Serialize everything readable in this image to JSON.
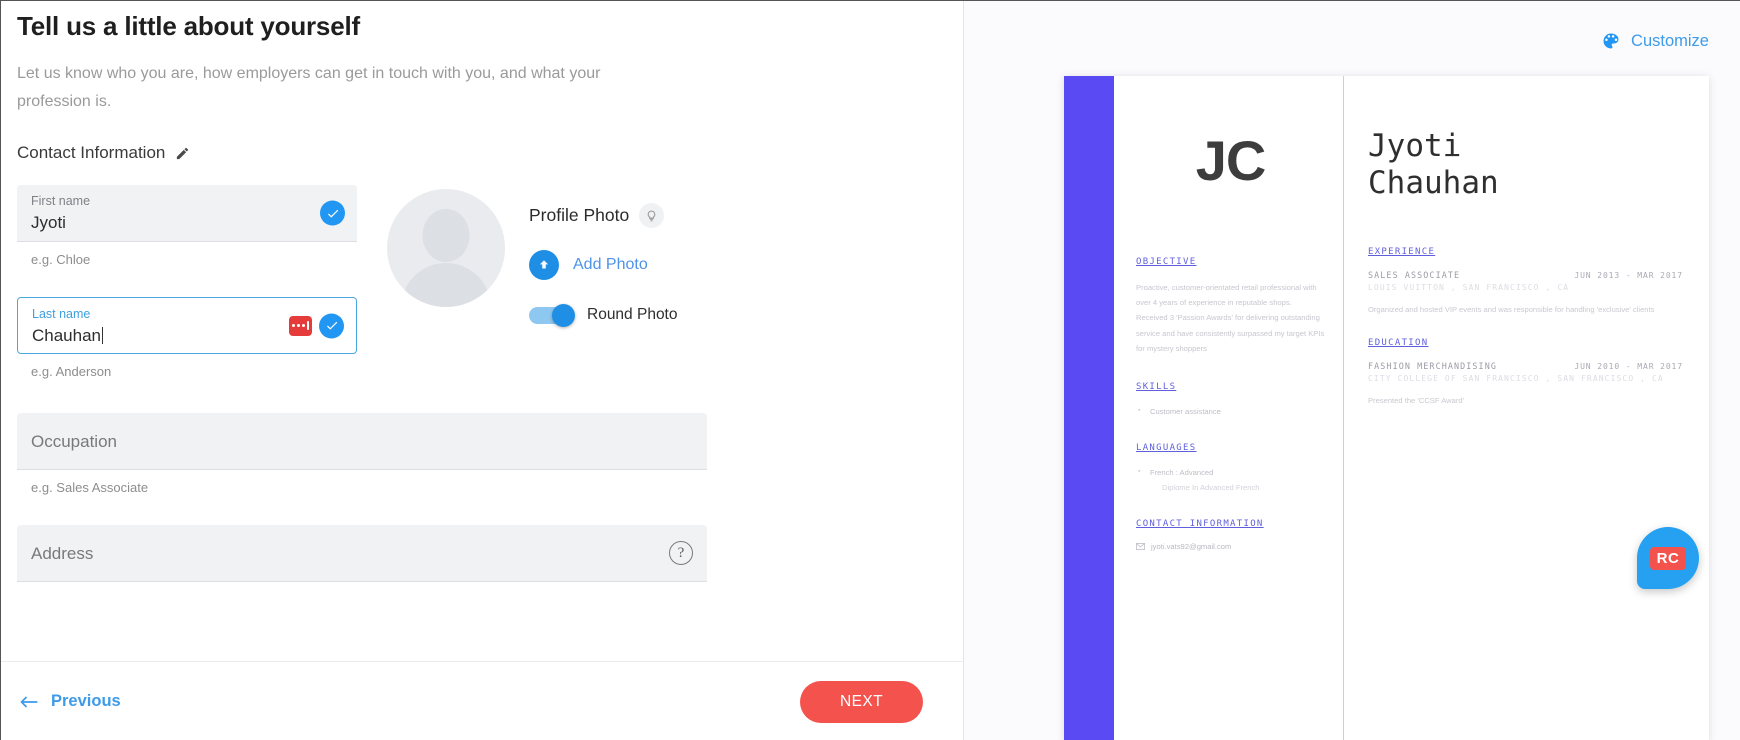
{
  "form": {
    "title": "Tell us a little about yourself",
    "subtitle": "Let us know who you are, how employers can get in touch with you, and what your profession is.",
    "section_title": "Contact Information",
    "fields": [
      {
        "label": "First name",
        "value": "Jyoti",
        "hint": "e.g. Chloe",
        "state": "filled"
      },
      {
        "label": "Last name",
        "value": "Chauhan",
        "hint": "e.g. Anderson",
        "state": "focused"
      },
      {
        "label": "Occupation",
        "value": "",
        "hint": "e.g. Sales Associate",
        "state": "empty"
      },
      {
        "label": "Address",
        "value": "",
        "hint": "",
        "state": "empty"
      }
    ],
    "photo": {
      "title": "Profile Photo",
      "add_label": "Add Photo",
      "round_label": "Round Photo",
      "round_enabled": true
    },
    "footer": {
      "previous_label": "Previous",
      "next_label": "NEXT"
    }
  },
  "preview": {
    "customize_label": "Customize",
    "accent_color": "#5a4af4",
    "monogram": "JC",
    "name": "Jyoti\nChauhan",
    "name_first": "Jyoti",
    "name_last": "Chauhan",
    "left_sections": {
      "objective_heading": "OBJECTIVE",
      "objective_body": "Proactive, customer-orientated retail professional with over 4 years of experience in reputable shops. Received 3 'Passion Awards' for delivering outstanding service and have consistently surpassed my target KPIs for mystery shoppers",
      "skills_heading": "SKILLS",
      "skills": [
        "Customer assistance"
      ],
      "languages_heading": "LANGUAGES",
      "languages": [
        "French : Advanced"
      ],
      "languages_sub": "Diplome In Advanced French",
      "contact_heading": "CONTACT INFORMATION",
      "email": "jyoti.vats92@gmail.com"
    },
    "right_sections": {
      "experience_heading": "EXPERIENCE",
      "experience": [
        {
          "title": "SALES ASSOCIATE",
          "date": "JUN 2013 - MAR 2017",
          "org": "LOUIS VUITTON , SAN FRANCISCO , CA",
          "desc": "Organized and hosted VIP events and was responsible for handling 'exclusive' clients"
        }
      ],
      "education_heading": "EDUCATION",
      "education": [
        {
          "title": "FASHION MERCHANDISING",
          "date": "JUN 2010 - MAR 2017",
          "org": "CITY COLLEGE OF SAN FRANCISCO , SAN FRANCISCO , CA",
          "desc": "Presented the 'CCSF Award'"
        }
      ]
    },
    "floating_badge": "RC"
  }
}
